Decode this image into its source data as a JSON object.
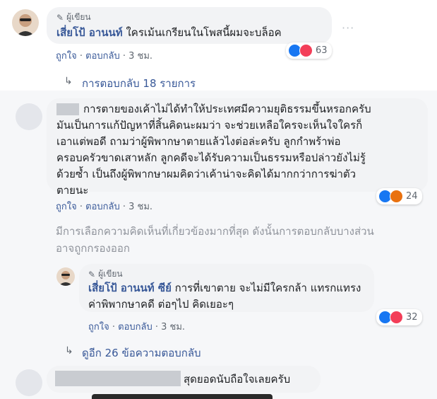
{
  "comment1": {
    "author_badge": "ผู้เขียน",
    "name": "เสี่ยโป้ อานนท์",
    "text": "ใครเม้นเกรียนในโพสนี้ผมจะบล็อค",
    "like": "ถูกใจ",
    "reply": "ตอบกลับ",
    "time": "3 ชม.",
    "reaction_count": "63",
    "more_icon": "ellipsis-icon"
  },
  "replies_link": "การตอบกลับ 18 รายการ",
  "comment2": {
    "text_lines": [
      "การตายของเค้าไม่ได้ทำให้ประเทศมีความยุติธรรมขึ้นหรอกครับ",
      "มันเป็นการแก้ปัญหาที่สิ้นคิดนะผมว่า จะช่วยเหลือใครจะเห็นใจใครก็",
      "เอาแต่พอดี ถามว่าผู้พิพากษาตายแล้วไงต่อล่ะครับ ลูกกำพร้าพ่อ",
      "ครอบครัวขาดเสาหลัก ลูกคดีจะได้รับความเป็นธรรมหรือปล่าวยังไม่รู้",
      "ด้วยซ้ำ เป็นถึงผู้พิพากษาผมคิดว่าเค้าน่าจะคิดได้มากกว่าการฆ่าตัว",
      "ตายนะ"
    ],
    "like": "ถูกใจ",
    "reply": "ตอบกลับ",
    "time": "3 ชม.",
    "reaction_count": "24"
  },
  "filter_notice_lines": [
    "มีการเลือกความคิดเห็นที่เกี่ยวข้องมากที่สุด ดังนั้นการตอบกลับบางส่วน",
    "อาจถูกกรองออก"
  ],
  "comment3": {
    "author_badge": "ผู้เขียน",
    "name": "เสี่ยโป้ อานนท์ ซีย์",
    "text_line1": "การที่เขาตาย จะไม่มีใครกล้า แทรกแทรง",
    "text_line2": "ค่าพิพากษาคดี ต่อๆไป คิดเยอะๆ",
    "like": "ถูกใจ",
    "reply": "ตอบกลับ",
    "time": "3 ชม.",
    "reaction_count": "32"
  },
  "more_replies_link": "ดูอีก 26 ข้อความตอบกลับ",
  "comment4": {
    "text": "สุดยอดนับถือใจเลยครับ"
  },
  "colors": {
    "link": "#385898",
    "bubble": "#f2f3f5",
    "like_blue": "#1877f2",
    "love_red": "#f33e58",
    "angry_orange": "#e9710f"
  }
}
